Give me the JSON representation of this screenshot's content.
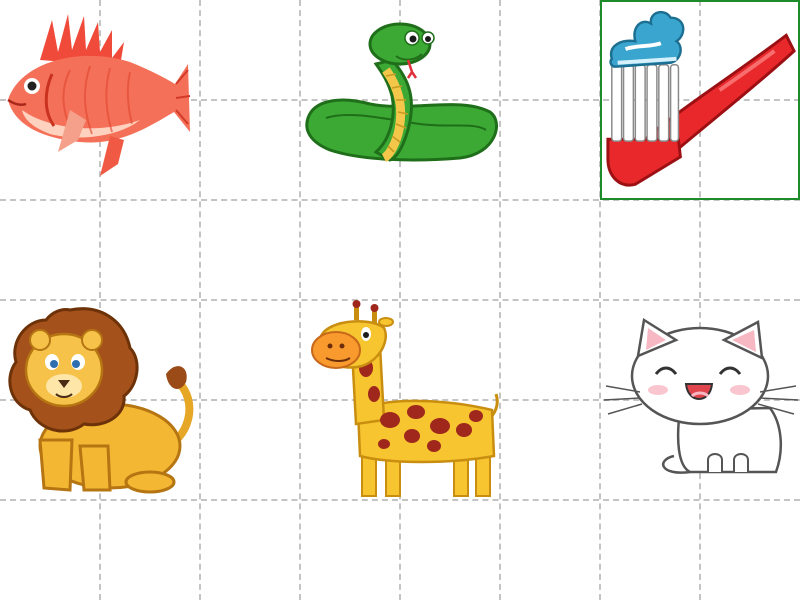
{
  "game": {
    "grid": {
      "columns": 8,
      "rows": 6,
      "line_color": "#c4c4c4"
    },
    "selection_color": "#1f8a2a",
    "cards": [
      {
        "id": "fish",
        "icon": "red-fish-icon",
        "row": 0,
        "col": 0,
        "selected": false
      },
      {
        "id": "snake",
        "icon": "green-snake-icon",
        "row": 0,
        "col": 1,
        "selected": false
      },
      {
        "id": "toothbrush",
        "icon": "toothbrush-icon",
        "row": 0,
        "col": 2,
        "selected": true
      },
      {
        "id": "lion",
        "icon": "lion-icon",
        "row": 1,
        "col": 0,
        "selected": false
      },
      {
        "id": "giraffe",
        "icon": "giraffe-icon",
        "row": 1,
        "col": 1,
        "selected": false
      },
      {
        "id": "cat",
        "icon": "white-cat-icon",
        "row": 1,
        "col": 2,
        "selected": false
      }
    ]
  }
}
